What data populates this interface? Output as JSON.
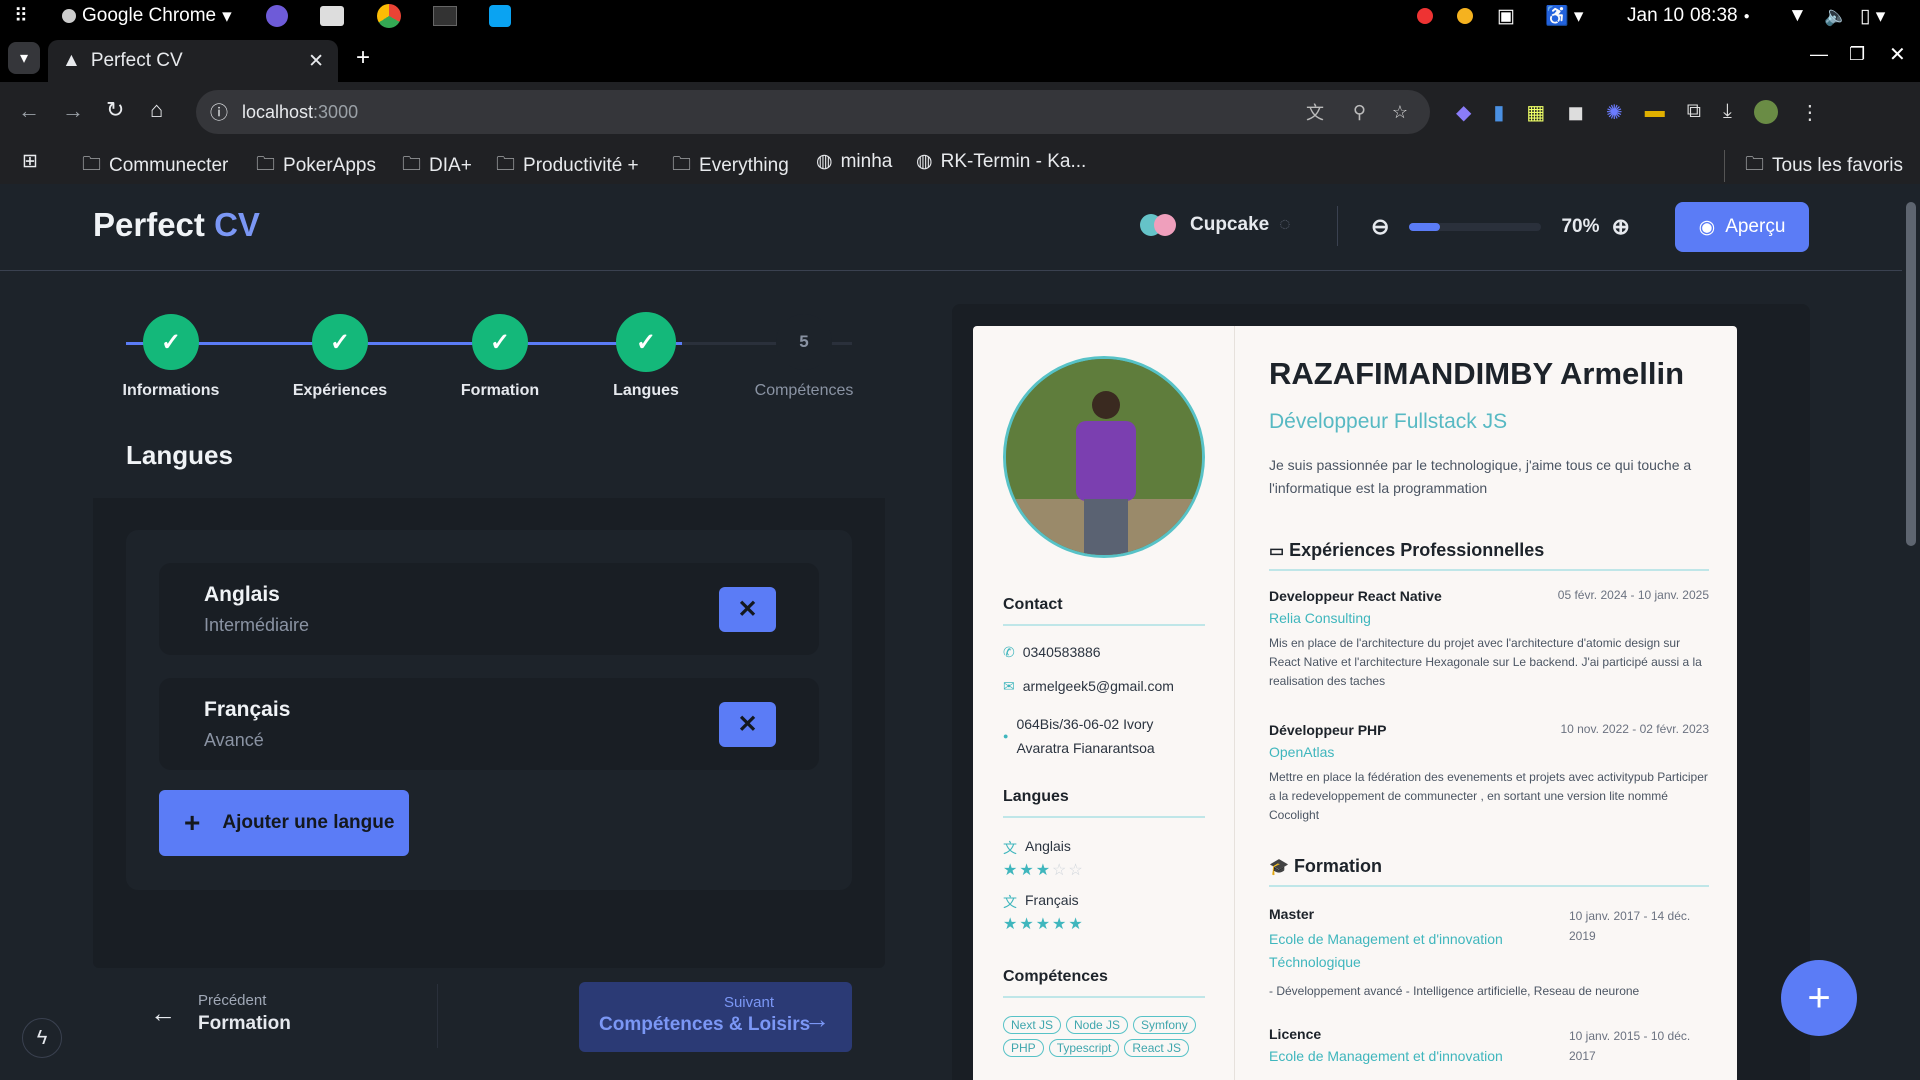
{
  "os": {
    "app_name": "Google Chrome",
    "date": "Jan 10",
    "time": "08:38"
  },
  "browser": {
    "tab_title": "Perfect CV",
    "url_host": "localhost",
    "url_port": ":3000",
    "bookmarks": [
      "Communecter",
      "PokerApps",
      "DIA+",
      "Productivité +",
      "Everything",
      "minha",
      "RK-Termin - Ka..."
    ],
    "all_bookmarks": "Tous les favoris"
  },
  "app": {
    "logo_main": "Perfect",
    "logo_accent": "CV",
    "theme_name": "Cupcake",
    "zoom_value": "70%",
    "zoom_fraction": 0.7,
    "preview_label": "Aperçu"
  },
  "steps": [
    {
      "label": "Informations",
      "done": true
    },
    {
      "label": "Expériences",
      "done": true
    },
    {
      "label": "Formation",
      "done": true
    },
    {
      "label": "Langues",
      "done": true
    },
    {
      "label": "Compétences",
      "done": false,
      "number": "5"
    }
  ],
  "form": {
    "title": "Langues",
    "languages": [
      {
        "name": "Anglais",
        "level": "Intermédiaire"
      },
      {
        "name": "Français",
        "level": "Avancé"
      }
    ],
    "add_label": "Ajouter une langue",
    "prev_caption": "Précédent",
    "prev_label": "Formation",
    "next_caption": "Suivant",
    "next_label": "Compétences & Loisirs"
  },
  "cv": {
    "name": "RAZAFIMANDIMBY Armellin",
    "role": "Développeur Fullstack JS",
    "about": "Je suis passionnée par le technologique, j'aime tous ce qui touche a l'informatique est la programmation",
    "contact_title": "Contact",
    "phone": "0340583886",
    "email": "armelgeek5@gmail.com",
    "address": "064Bis/36-06-02 Ivory Avaratra Fianarantsoa",
    "languages_title": "Langues",
    "languages": [
      {
        "name": "Anglais",
        "stars": 3
      },
      {
        "name": "Français",
        "stars": 5
      }
    ],
    "skills_title": "Compétences",
    "skills": [
      "Next JS",
      "Node JS",
      "Symfony",
      "PHP",
      "Typescript",
      "React JS"
    ],
    "experience_title": "Expériences Professionnelles",
    "experiences": [
      {
        "title": "Developpeur React Native",
        "dates": "05 févr. 2024 - 10 janv. 2025",
        "company": "Relia Consulting",
        "desc": "Mis en place de l'architecture du projet avec l'architecture d'atomic design sur React Native et l'architecture Hexagonale sur Le backend. J'ai participé aussi a la realisation des taches"
      },
      {
        "title": "Développeur PHP",
        "dates": "10 nov. 2022 - 02 févr. 2023",
        "company": "OpenAtlas",
        "desc": "Mettre en place la fédération des evenements et projets avec activitypub Participer a la redeveloppement de communecter , en sortant une version lite nommé Cocolight"
      }
    ],
    "education_title": "Formation",
    "education": [
      {
        "title": "Master",
        "dates": "10 janv. 2017 - 14 déc. 2019",
        "school": "Ecole de Management et d'innovation Téchnologique",
        "desc": "- Développement avancé - Intelligence artificielle, Reseau de neurone"
      },
      {
        "title": "Licence",
        "dates": "10 janv. 2015 - 10 déc. 2017",
        "school": "Ecole de Management et d'innovation",
        "desc": ""
      }
    ]
  }
}
